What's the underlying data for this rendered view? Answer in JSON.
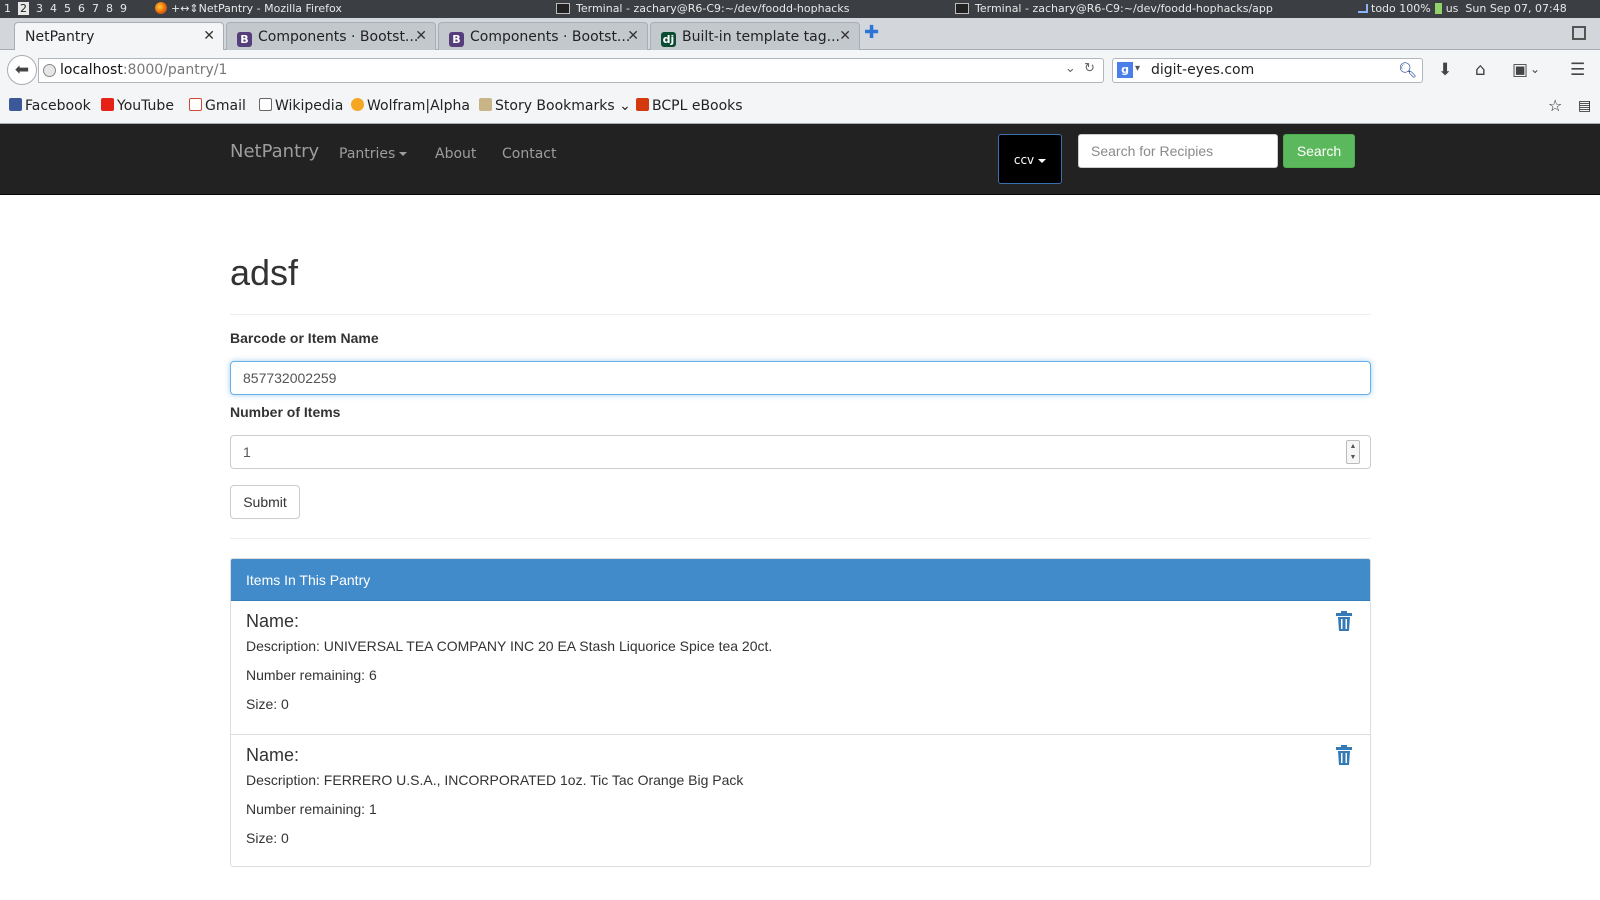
{
  "system_bar": {
    "workspaces": [
      "1",
      "2",
      "3",
      "4",
      "5",
      "6",
      "7",
      "8",
      "9"
    ],
    "active_workspace_index": 1,
    "window_title": "NetPantry - Mozilla Firefox",
    "window_title_prefix": "+↔⇕",
    "terminal_1": "Terminal - zachary@R6-C9:~/dev/foodd-hophacks",
    "terminal_2": "Terminal - zachary@R6-C9:~/dev/foodd-hophacks/app",
    "status": "todo 100%",
    "layout": "us",
    "clock": "Sun Sep 07, 07:48"
  },
  "tabs": [
    {
      "label": "NetPantry",
      "active": true
    },
    {
      "label": "Components · Bootst...",
      "active": false
    },
    {
      "label": "Components · Bootst...",
      "active": false
    },
    {
      "label": "Built-in template tag...",
      "active": false
    }
  ],
  "urlbar": {
    "host": "localhost",
    "path": ":8000/pantry/1"
  },
  "browser_search": {
    "value": "digit-eyes.com"
  },
  "bookmarks": [
    {
      "label": "Facebook",
      "icon": "facebook-icon"
    },
    {
      "label": "YouTube",
      "icon": "youtube-icon"
    },
    {
      "label": "Gmail",
      "icon": "gmail-icon"
    },
    {
      "label": "Wikipedia",
      "icon": "wikipedia-icon"
    },
    {
      "label": "Wolfram|Alpha",
      "icon": "wolframalpha-icon"
    },
    {
      "label": "Story Bookmarks",
      "icon": "folder-icon"
    },
    {
      "label": "BCPL eBooks",
      "icon": "bcpl-icon"
    }
  ],
  "site_nav": {
    "brand": "NetPantry",
    "links": [
      "Pantries",
      "About",
      "Contact"
    ],
    "user_button": "ccv",
    "recipe_search_placeholder": "Search for Recipies",
    "recipe_search_button": "Search"
  },
  "pantry": {
    "title": "adsf",
    "barcode_label": "Barcode or Item Name",
    "barcode_value": "857732002259",
    "quantity_label": "Number of Items",
    "quantity_value": "1",
    "submit_label": "Submit",
    "items_heading": "Items In This Pantry",
    "items": [
      {
        "name": "Name:",
        "description": "Description: UNIVERSAL TEA COMPANY INC 20 EA Stash Liquorice Spice tea 20ct.",
        "remaining": "Number remaining: 6",
        "size": "Size: 0"
      },
      {
        "name": "Name:",
        "description": "Description: FERRERO U.S.A., INCORPORATED 1oz. Tic Tac Orange Big Pack",
        "remaining": "Number remaining: 1",
        "size": "Size: 0"
      }
    ]
  },
  "colors": {
    "navbar_bg": "#222222",
    "panel_primary": "#428bca",
    "search_button": "#5cb85c",
    "trash_icon": "#337ab7"
  }
}
